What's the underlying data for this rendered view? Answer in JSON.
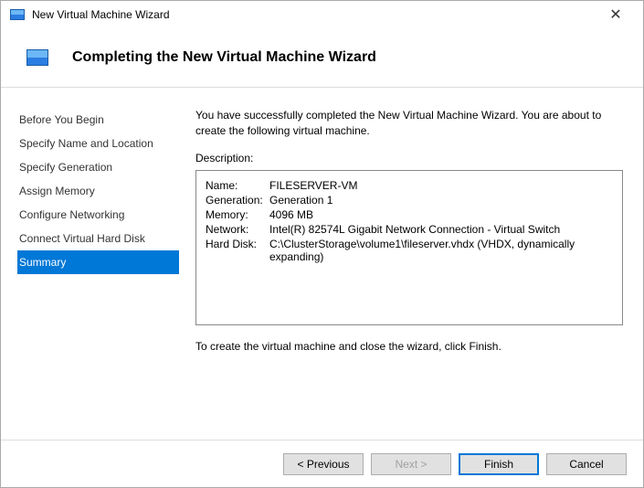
{
  "window": {
    "title": "New Virtual Machine Wizard"
  },
  "header": {
    "title": "Completing the New Virtual Machine Wizard"
  },
  "sidebar": {
    "items": [
      {
        "label": "Before You Begin"
      },
      {
        "label": "Specify Name and Location"
      },
      {
        "label": "Specify Generation"
      },
      {
        "label": "Assign Memory"
      },
      {
        "label": "Configure Networking"
      },
      {
        "label": "Connect Virtual Hard Disk"
      },
      {
        "label": "Summary"
      }
    ]
  },
  "content": {
    "intro": "You have successfully completed the New Virtual Machine Wizard. You are about to create the following virtual machine.",
    "description_label": "Description:",
    "rows": [
      {
        "label": "Name:",
        "value": "FILESERVER-VM"
      },
      {
        "label": "Generation:",
        "value": "Generation 1"
      },
      {
        "label": "Memory:",
        "value": "4096 MB"
      },
      {
        "label": "Network:",
        "value": "Intel(R) 82574L Gigabit Network Connection - Virtual Switch"
      },
      {
        "label": "Hard Disk:",
        "value": "C:\\ClusterStorage\\volume1\\fileserver.vhdx (VHDX, dynamically expanding)"
      }
    ],
    "footnote": "To create the virtual machine and close the wizard, click Finish."
  },
  "footer": {
    "previous": "< Previous",
    "next": "Next >",
    "finish": "Finish",
    "cancel": "Cancel"
  }
}
